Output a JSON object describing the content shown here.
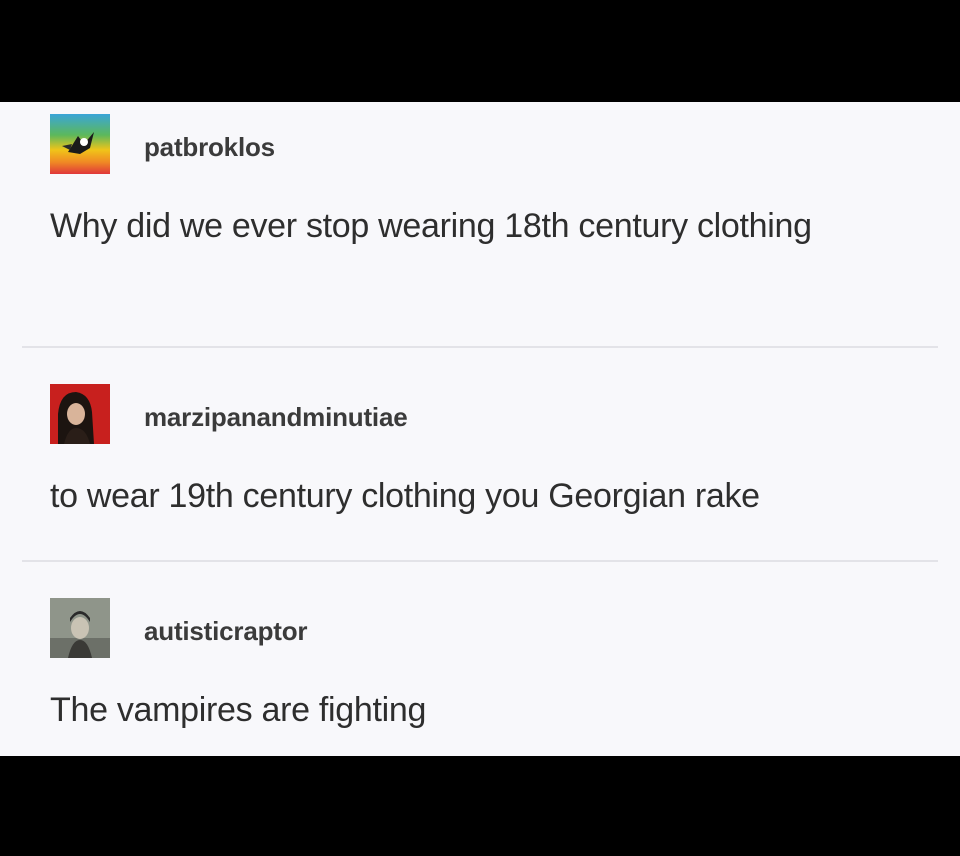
{
  "thread": {
    "posts": [
      {
        "username": "patbroklos",
        "avatar_icon": "rainbow-avatar-icon",
        "text": "Why did we ever stop wearing 18th century clothing"
      },
      {
        "username": "marzipanandminutiae",
        "avatar_icon": "portrait-avatar-icon",
        "text": "to wear 19th century clothing you Georgian rake"
      },
      {
        "username": "autisticraptor",
        "avatar_icon": "photo-avatar-icon",
        "text": "The vampires are fighting"
      }
    ]
  },
  "colors": {
    "panel_background": "#f8f8fb",
    "frame": "#000000",
    "text": "#2e2e2e",
    "divider": "#e3e3e8"
  }
}
